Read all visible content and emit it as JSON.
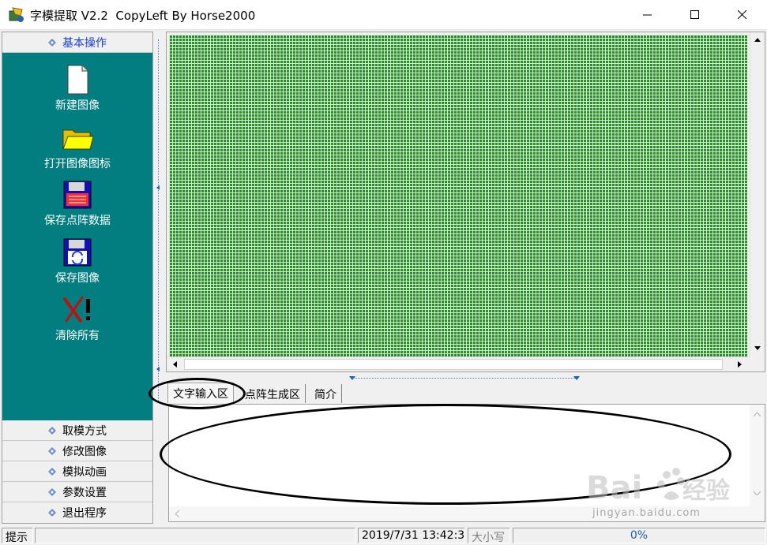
{
  "window": {
    "title": "字模提取 V2.2  CopyLeft By Horse2000"
  },
  "sidebar": {
    "top_category": "基本操作",
    "tools": [
      {
        "label": "新建图像",
        "icon": "new-document-icon"
      },
      {
        "label": "打开图像图标",
        "icon": "folder-icon"
      },
      {
        "label": "保存点阵数据",
        "icon": "save-data-floppy-icon"
      },
      {
        "label": "保存图像",
        "icon": "save-image-floppy-icon"
      },
      {
        "label": "清除所有",
        "icon": "clear-x-icon"
      }
    ],
    "bottom_categories": [
      "取模方式",
      "修改图像",
      "模拟动画",
      "参数设置",
      "退出程序"
    ]
  },
  "tabs": [
    "文字输入区",
    "点阵生成区",
    "简介"
  ],
  "text_input": {
    "value": ""
  },
  "statusbar": {
    "hint_label": "提示",
    "hint_text": "",
    "datetime": "2019/7/31 13:42:31",
    "caps": "大小写",
    "progress": "0%"
  },
  "watermark": {
    "text": "jingyan.baidu.com"
  },
  "colors": {
    "tool_area": "#037e80",
    "grid_green": "#2f8a2f",
    "active_category": "#1a3ddb"
  }
}
